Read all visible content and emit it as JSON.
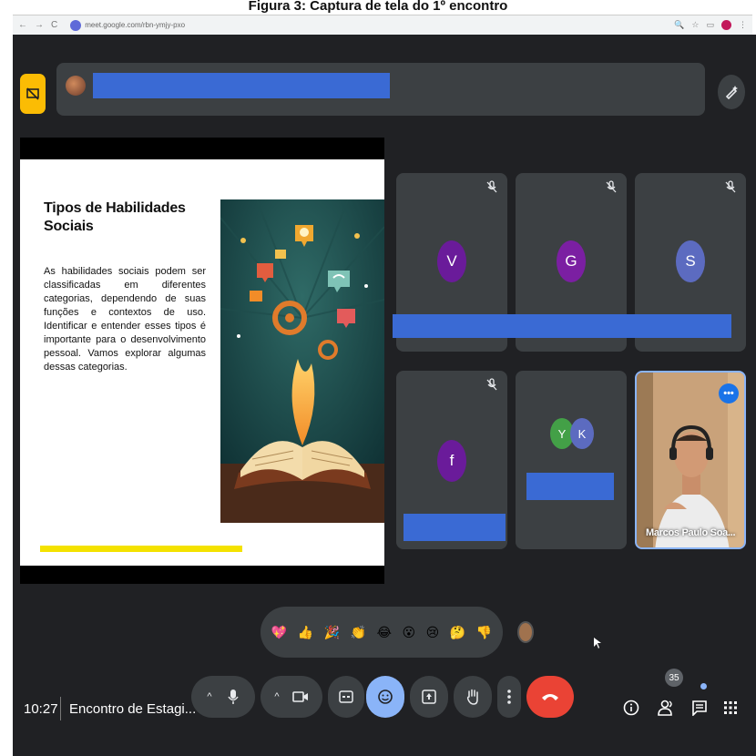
{
  "caption": "Figura 3: Captura de tela do 1º encontro",
  "browser": {
    "url": "meet.google.com/rbn-ymjy-pxo"
  },
  "slide": {
    "title": "Tipos de Habilidades Sociais",
    "body": "As habilidades sociais podem ser classificadas em diferentes categorias, dependendo de suas funções e contextos de uso. Identificar e entender esses tipos é importante para o desenvolvimento pessoal. Vamos explorar algumas dessas categorias."
  },
  "participants": [
    {
      "initial": "V",
      "color": "#6a1b9a"
    },
    {
      "initial": "G",
      "color": "#7b1fa2"
    },
    {
      "initial": "S",
      "color": "#5c6bc0"
    },
    {
      "initial": "f",
      "color": "#6a1b9a"
    },
    {
      "initial": "Y",
      "color": "#43a047"
    },
    {
      "initial": "K",
      "color": "#5c6bc0"
    }
  ],
  "self_tile": {
    "name": "Marcos Paulo Soa..."
  },
  "reactions": [
    "💖",
    "👍",
    "🎉",
    "👏",
    "😂",
    "😮",
    "😢",
    "🤔",
    "👎"
  ],
  "bottom_bar": {
    "time": "10:27",
    "meeting_name": "Encontro de Estagi...",
    "participants_count": "35"
  },
  "colors": {
    "meet_bg": "#202124",
    "tile_bg": "#3c4043",
    "accent_blue": "#8ab4f8",
    "end_call": "#ea4335",
    "redaction": "#3a6ad4",
    "slide_accent": "#f4e200"
  }
}
